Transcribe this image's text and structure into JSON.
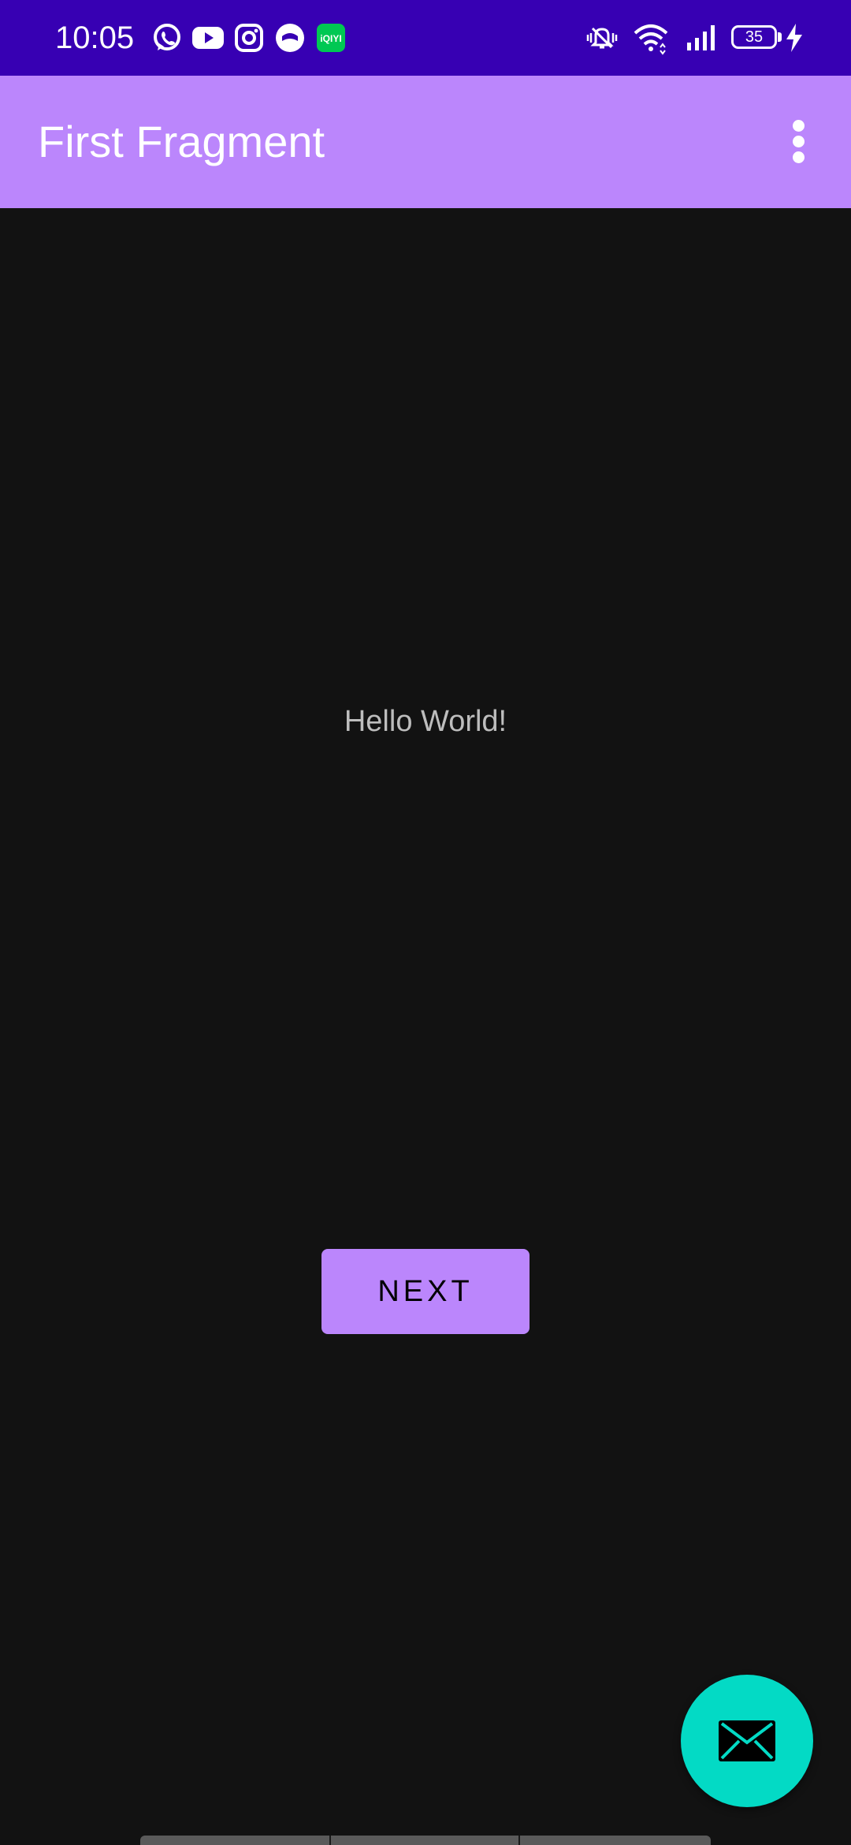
{
  "status_bar": {
    "time": "10:05",
    "notification_icons": [
      "whatsapp-icon",
      "youtube-icon",
      "instagram-icon",
      "messenger-icon",
      "iqiyi-icon"
    ],
    "iqiyi_label": "iQIYI",
    "battery_level": "35",
    "colors": {
      "background": "#3700B3",
      "iqiyi": "#00C853"
    }
  },
  "app_bar": {
    "title": "First Fragment",
    "overflow_icon": "more-vert-icon",
    "color": "#BB86FC"
  },
  "main": {
    "hello_text": "Hello World!",
    "next_label": "NEXT"
  },
  "fab": {
    "icon": "email-icon",
    "color": "#03DAC5"
  },
  "colors": {
    "background": "#121212",
    "primary": "#BB86FC",
    "secondary": "#03DAC5"
  }
}
